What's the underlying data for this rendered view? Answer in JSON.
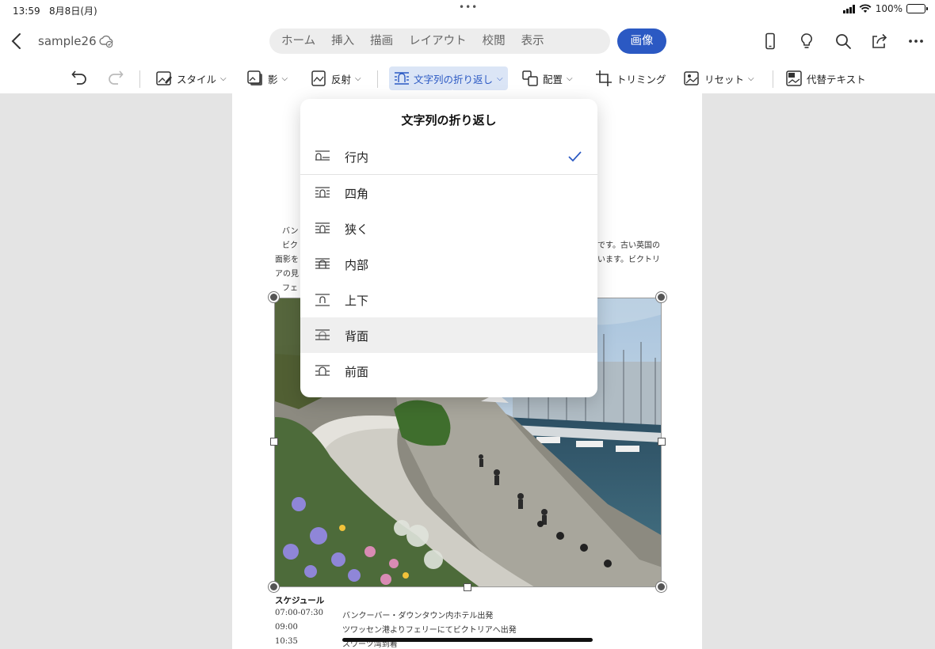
{
  "status_bar": {
    "time": "13:59",
    "date": "8月8日(月)",
    "battery": "100%"
  },
  "header": {
    "doc_name": "sample26",
    "tabs": [
      "ホーム",
      "挿入",
      "描画",
      "レイアウト",
      "校閲",
      "表示"
    ],
    "active_tab": "画像"
  },
  "ribbon": {
    "style": "スタイル",
    "shadow": "影",
    "reflection": "反射",
    "wrap": "文字列の折り返し",
    "arrange": "配置",
    "crop": "トリミング",
    "reset": "リセット",
    "alt_text": "代替テキスト"
  },
  "popover": {
    "title": "文字列の折り返し",
    "options": [
      "行内",
      "四角",
      "狭く",
      "内部",
      "上下",
      "背面",
      "前面"
    ],
    "selected": "行内",
    "highlighted": "背面"
  },
  "document": {
    "para_fragments": [
      "バン",
      "ビク",
      "です。古い英国の",
      "面影を",
      "います。ビクトリ",
      "アの見",
      "フェ"
    ],
    "schedule_heading": "スケジュール",
    "schedule": [
      {
        "time": "07:00-07:30",
        "desc": "バンクーバー・ダウンタウン内ホテル出発"
      },
      {
        "time": "09:00",
        "desc": "ツワッセン港よりフェリーにてビクトリアへ出発"
      },
      {
        "time": "10:35",
        "desc": "スワーツ湾到着"
      }
    ]
  },
  "colors": {
    "accent": "#2b59c3",
    "ribbon_selected_bg": "#dbe5f6",
    "canvas": "#e4e4e4"
  }
}
